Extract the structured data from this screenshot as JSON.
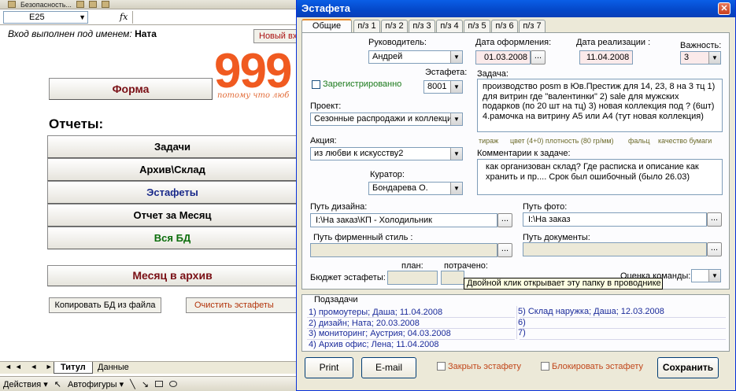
{
  "excel": {
    "toolbar_text": "Безопасность...",
    "name_box": "E25",
    "fx_label": "fx",
    "login_label": "Вход выполнен под именем:",
    "login_user": "Ната",
    "new_button": "Новый вх",
    "logo_digits": "999",
    "logo_slogan": "потому что люб",
    "form_button": "Форма",
    "reports_title": "Отчеты:",
    "reports": [
      "Задачи",
      "Архив\\Склад",
      "Эстафеты",
      "Отчет за Месяц",
      "Вся БД"
    ],
    "month_archive_button": "Месяц в архив",
    "copy_db_button": "Копировать БД из файла",
    "clear_relays_button": "Очистить эстафеты",
    "sheet_nav": "◄◄ ◄ ► ►►",
    "sheet_tabs": [
      "Титул",
      "Данные"
    ],
    "draw_actions": "Действия ▾",
    "autoshapes": "Автофигуры ▾"
  },
  "dialog": {
    "title": "Эстафета",
    "close_symbol": "✕",
    "tabs": [
      "Общие данные",
      "п/з 1",
      "п/з 2",
      "п/з 3",
      "п/з 4",
      "п/з 5",
      "п/з 6",
      "п/з 7"
    ],
    "manager_label": "Руководитель:",
    "manager_value": "Андрей",
    "date_created_label": "Дата оформления:",
    "date_created_value": "01.03.2008",
    "date_done_label": "Дата реализации :",
    "date_done_value": "11.04.2008",
    "importance_label": "Важность:",
    "importance_value": "3",
    "registered_label": "Зарегистрированно",
    "relay_label": "Эстафета:",
    "relay_value": "8001",
    "task_label": "Задача:",
    "task_text": "производство posm в Юв.Престиж для 14, 23, 8 на 3 тц 1) для витрин где \"валентинки\" 2) sale для мужских подарков (по 20 шт на тц) 3) новая коллекция под ? (6шт) 4.рамочка на витрину А5 или А4 (тут новая коллекция)",
    "project_label": "Проект:",
    "project_value": "Сезонные распродажи и коллекции",
    "print_specs": [
      "тираж",
      "цвет (4+0) плотность (80 гр/мм)",
      "фальц",
      "качество бумаги"
    ],
    "action_label": "Акция:",
    "action_value": "из любви к искусству2",
    "comment_label": "Комментарии к задаче:",
    "comment_text": "как организован склад? Где расписка и описание как хранить и пр.... Срок был ошибочный (было 26.03)",
    "curator_label": "Куратор:",
    "curator_value": "Бондарева О.",
    "design_path_label": "Путь дизайна:",
    "design_path_value": "I:\\На заказ\\КП - Холодильник",
    "photo_path_label": "Путь фото:",
    "photo_path_value": "I:\\На заказ",
    "brand_path_label": "Путь фирменный стиль :",
    "brand_path_value": "",
    "docs_path_label": "Путь документы:",
    "docs_path_value": "",
    "plan_label": "план:",
    "spent_label": "потрачено:",
    "budget_label": "Бюджет эстафеты:",
    "team_rating_label": "Оценка команды:",
    "tooltip": "Двойной клик открывает эту папку в проводнике",
    "dots": "...",
    "subtasks_title": "Подзадачи",
    "subtasks_left": [
      "1) промоутеры; Даша; 11.04.2008",
      "2) дизайн; Ната; 20.03.2008",
      "3) мониторинг; Аустрия; 04.03.2008",
      "4) Архив офис; Лена; 11.04.2008"
    ],
    "subtasks_right": [
      "5) Склад наружка; Даша; 12.03.2008",
      "6)",
      "7)"
    ],
    "print_button": "Print",
    "email_button": "E-mail",
    "close_relay_label": "Закрыть эстафету",
    "block_relay_label": "Блокировать эстафету",
    "save_button": "Сохранить"
  }
}
